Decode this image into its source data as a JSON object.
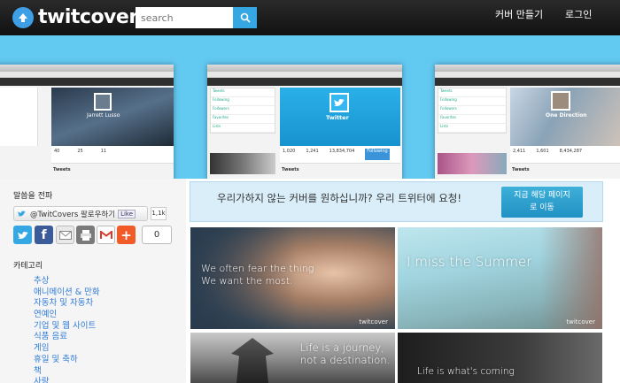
{
  "header": {
    "logo_text": "twitcover",
    "search_placeholder": "search",
    "nav": [
      "커버 만들기",
      "로그인"
    ]
  },
  "hero": {
    "shots": [
      {
        "profile_name": "Jarrett Lusso",
        "stats": [
          "40",
          "25",
          "11"
        ],
        "tweets_label": "Tweets"
      },
      {
        "profile_name": "Twitter",
        "stats": [
          "1,020",
          "1,241",
          "13,834,704"
        ],
        "tweets_label": "Tweets",
        "button": "Following"
      },
      {
        "profile_name": "One Direction",
        "stats": [
          "2,411",
          "1,601",
          "8,434,287"
        ],
        "tweets_label": "Tweets"
      }
    ]
  },
  "sidebar": {
    "share_title": "말씀을 전파",
    "follow_label": "@TwitCovers 팔로우하기",
    "like_label": "Like",
    "like_count": "1,1k",
    "share_count": "0",
    "category_title": "카테고리",
    "categories": [
      "추상",
      "애니메이션 & 만화",
      "자동차 및 자동차",
      "연예인",
      "기업 및 웹 사이트",
      "식품 음료",
      "게임",
      "휴일 및 축하",
      "책",
      "사랑"
    ]
  },
  "request": {
    "text": "우리가하지 않는 커버를 원하십니까? 우리 트위터에 요청!",
    "button_line1": "지금 해당 페이지",
    "button_line2": "로 이동"
  },
  "gallery": [
    {
      "text_line1": "We often fear the thing",
      "text_line2": "We want the most.",
      "watermark": "twitcover"
    },
    {
      "text_line1": "I miss the Summer",
      "text_line2": "",
      "watermark": "twitcover"
    },
    {
      "text_line1": "Life is a journey,",
      "text_line2": "not a destination.",
      "watermark": ""
    },
    {
      "text_line1": "Life is what's coming",
      "text_line2": "",
      "watermark": ""
    }
  ],
  "colors": {
    "accent": "#35a8e3",
    "hero_bg": "#62c9f1",
    "link": "#2f7bd8"
  }
}
